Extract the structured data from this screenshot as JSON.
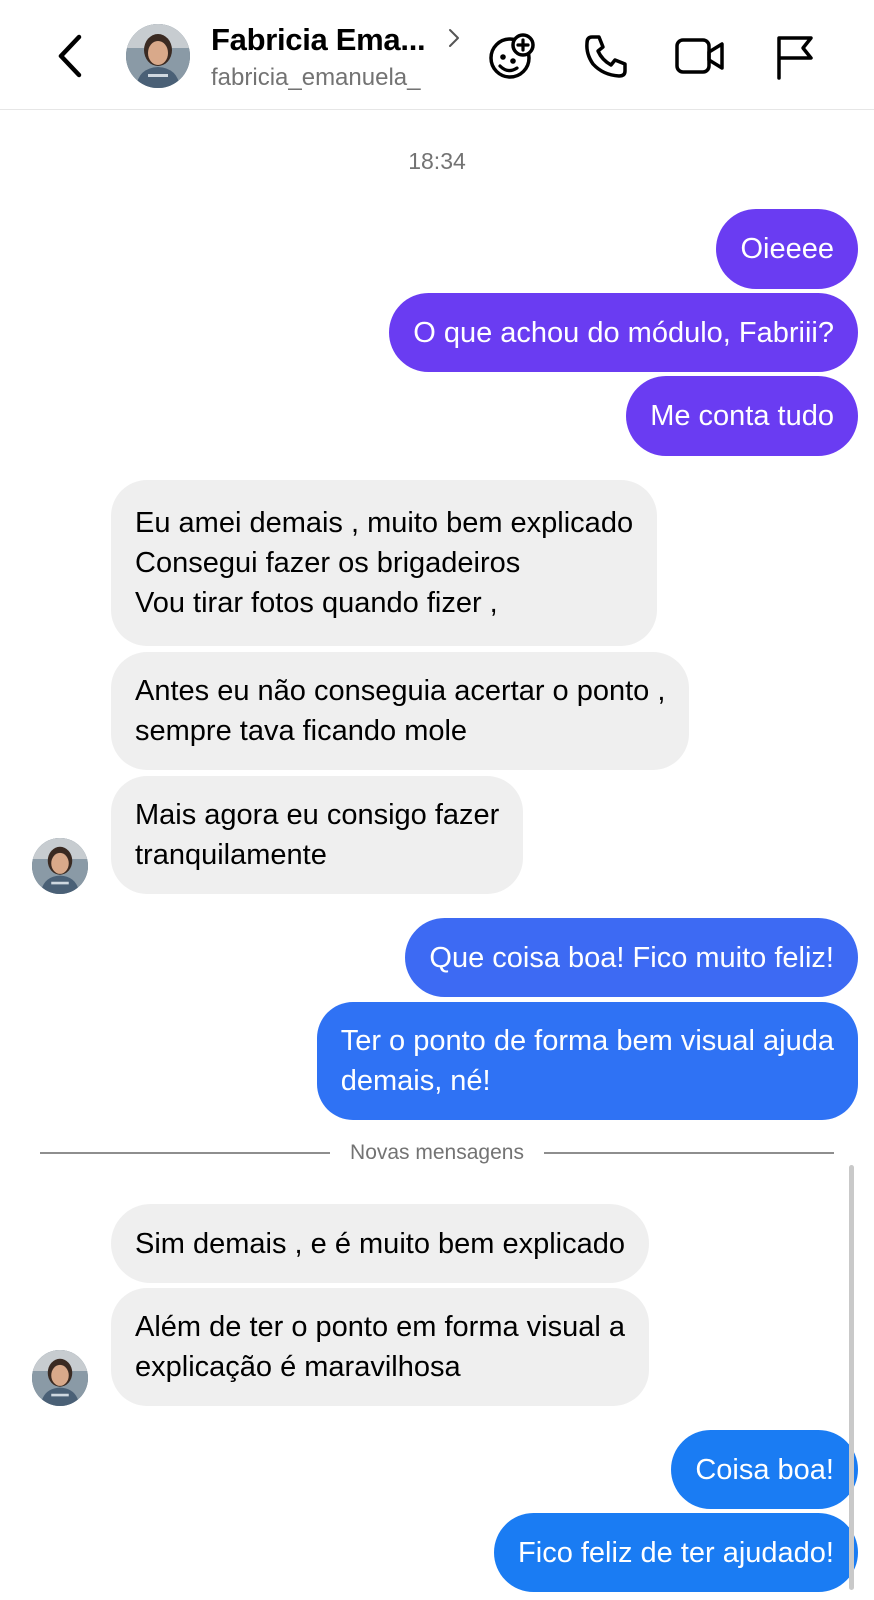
{
  "header": {
    "contact_name": "Fabricia Ema...",
    "username": "fabricia_emanuela_"
  },
  "icons": {
    "back": "chevron-left-icon",
    "effects": "add-effect-icon",
    "call": "phone-icon",
    "video": "video-camera-icon",
    "report": "flag-icon"
  },
  "chat": {
    "timestamp": "18:34",
    "divider_label": "Novas mensagens",
    "messages": [
      {
        "lines": [
          "Oieeee"
        ]
      },
      {
        "lines": [
          "O que achou do módulo, Fabriii?"
        ]
      },
      {
        "lines": [
          "Me conta tudo"
        ]
      },
      {
        "lines": [
          "Eu amei demais , muito bem explicado",
          "Consegui fazer os brigadeiros",
          "Vou tirar fotos quando fizer ,"
        ]
      },
      {
        "lines": [
          "Antes eu não conseguia acertar o ponto ,",
          "sempre tava ficando mole"
        ]
      },
      {
        "lines": [
          "Mais agora eu consigo fazer",
          "tranquilamente"
        ]
      },
      {
        "lines": [
          "Que coisa boa! Fico muito feliz!"
        ]
      },
      {
        "lines": [
          "Ter o ponto de forma bem visual ajuda",
          "demais, né!"
        ]
      },
      {
        "lines": [
          "Sim demais , e é muito bem explicado"
        ]
      },
      {
        "lines": [
          "Além de ter o ponto em forma visual a",
          "explicação é maravilhosa"
        ]
      },
      {
        "lines": [
          "Coisa boa!"
        ]
      },
      {
        "lines": [
          "Fico feliz de ter ajudado!"
        ]
      }
    ]
  },
  "colors": {
    "outgoing_purple": "#6a3cf2",
    "outgoing_blue_mid": "#3d6af3",
    "outgoing_blue": "#1a7cf3",
    "incoming": "#efefef"
  }
}
